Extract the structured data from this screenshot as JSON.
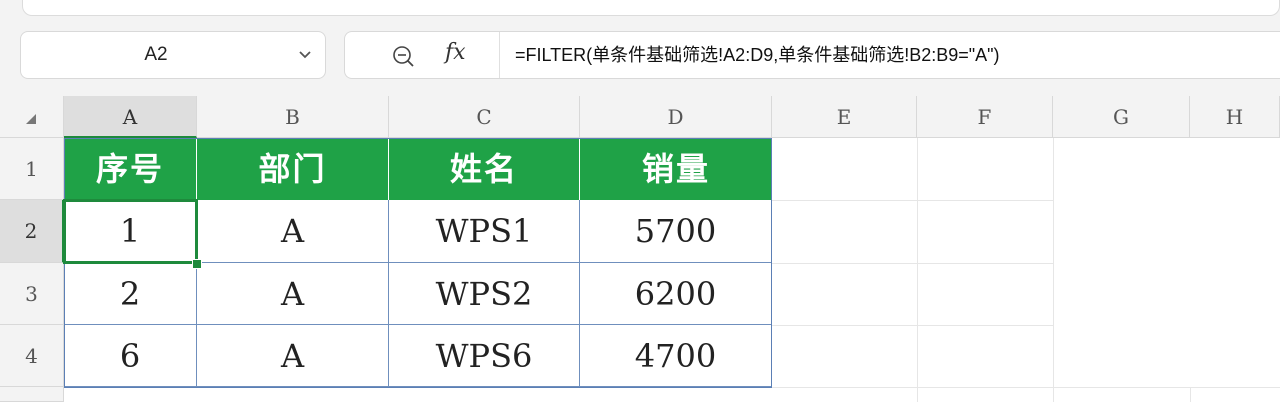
{
  "name_box": {
    "value": "A2"
  },
  "formula_bar": {
    "fx_label": "fx",
    "formula": "=FILTER(单条件基础筛选!A2:D9,单条件基础筛选!B2:B9=\"A\")"
  },
  "columns": [
    "A",
    "B",
    "C",
    "D",
    "E",
    "F",
    "G",
    "H"
  ],
  "rows": [
    "1",
    "2",
    "3",
    "4"
  ],
  "table": {
    "headers": [
      "序号",
      "部门",
      "姓名",
      "销量"
    ],
    "body": [
      [
        "1",
        "A",
        "WPS1",
        "5700"
      ],
      [
        "2",
        "A",
        "WPS2",
        "6200"
      ],
      [
        "6",
        "A",
        "WPS6",
        "4700"
      ]
    ]
  },
  "selection": {
    "active_cell": "A2"
  },
  "colors": {
    "header_fill": "#1fa247",
    "selection": "#1e8a3c",
    "table_border": "#5b7fb5"
  },
  "icons": {
    "name_box_dropdown": "chevron-down-icon",
    "zoom": "zoom-search-icon",
    "select_all": "select-all-icon"
  }
}
